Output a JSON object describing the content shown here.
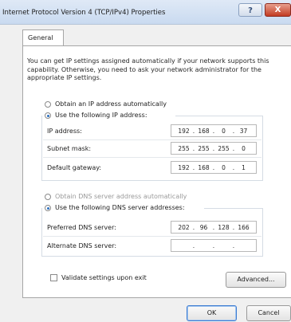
{
  "window": {
    "title": "Internet Protocol Version 4 (TCP/IPv4) Properties",
    "help_label": "?",
    "close_label": "X"
  },
  "tabs": [
    {
      "label": "General"
    }
  ],
  "general": {
    "intro_text": "You can get IP settings assigned automatically if your network supports this capability. Otherwise, you need to ask your network administrator for the appropriate IP settings.",
    "ip_mode": {
      "auto_label": "Obtain an IP address automatically",
      "manual_label": "Use the following IP address:",
      "selected": "manual"
    },
    "ip_fields": [
      {
        "label": "IP address:",
        "octets": [
          "192",
          "168",
          "0",
          "37"
        ]
      },
      {
        "label": "Subnet mask:",
        "octets": [
          "255",
          "255",
          "255",
          "0"
        ]
      },
      {
        "label": "Default gateway:",
        "octets": [
          "192",
          "168",
          "0",
          "1"
        ]
      }
    ],
    "dns_mode": {
      "auto_label": "Obtain DNS server address automatically",
      "manual_label": "Use the following DNS server addresses:",
      "selected": "manual"
    },
    "dns_fields": [
      {
        "label": "Preferred DNS server:",
        "octets": [
          "202",
          "96",
          "128",
          "166"
        ]
      },
      {
        "label": "Alternate DNS server:",
        "octets": [
          "",
          "",
          "",
          ""
        ]
      }
    ],
    "validate_label": "Validate settings upon exit",
    "validate_checked": false,
    "advanced_label": "Advanced..."
  },
  "footer": {
    "ok_label": "OK",
    "cancel_label": "Cancel"
  }
}
